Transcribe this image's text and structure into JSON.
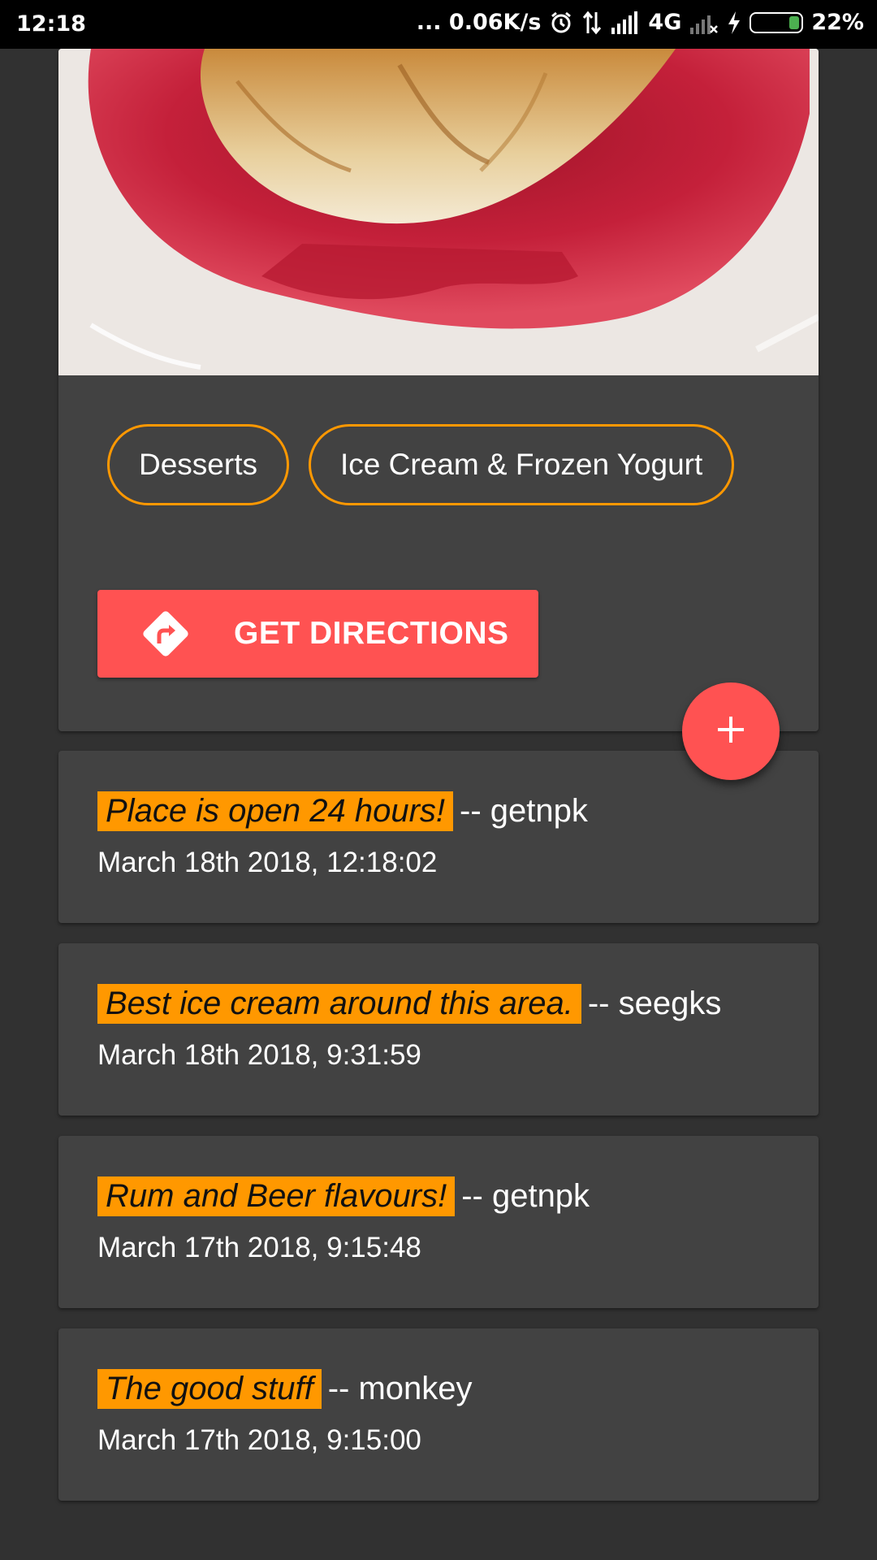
{
  "status_bar": {
    "time": "12:18",
    "network_speed": "... 0.06K/s",
    "network_type": "4G",
    "battery_percent": "22%",
    "battery_level": 0.22,
    "icons": [
      "alarm-icon",
      "data-transfer-icon",
      "signal-icon",
      "signal-no-sim-icon",
      "charging-icon",
      "battery-icon"
    ]
  },
  "place": {
    "photo": "dessert-photo",
    "categories": [
      "Desserts",
      "Ice Cream & Frozen Yogurt"
    ],
    "directions_label": "GET DIRECTIONS",
    "directions_icon": "directions-icon",
    "add_icon": "plus-icon"
  },
  "colors": {
    "accent": "#ff5252",
    "chip_border": "#ff9800",
    "highlight": "#ff9800",
    "card_bg": "#424242",
    "page_bg": "#313131"
  },
  "reviews": [
    {
      "text": "Place is open 24 hours!",
      "author": "-- getnpk",
      "date": "March 18th 2018, 12:18:02"
    },
    {
      "text": "Best ice cream around this area.",
      "author": "-- seegks",
      "date": "March 18th 2018, 9:31:59"
    },
    {
      "text": "Rum and Beer flavours!",
      "author": "-- getnpk",
      "date": "March 17th 2018, 9:15:48"
    },
    {
      "text": "The good stuff",
      "author": "-- monkey",
      "date": "March 17th 2018, 9:15:00"
    }
  ]
}
